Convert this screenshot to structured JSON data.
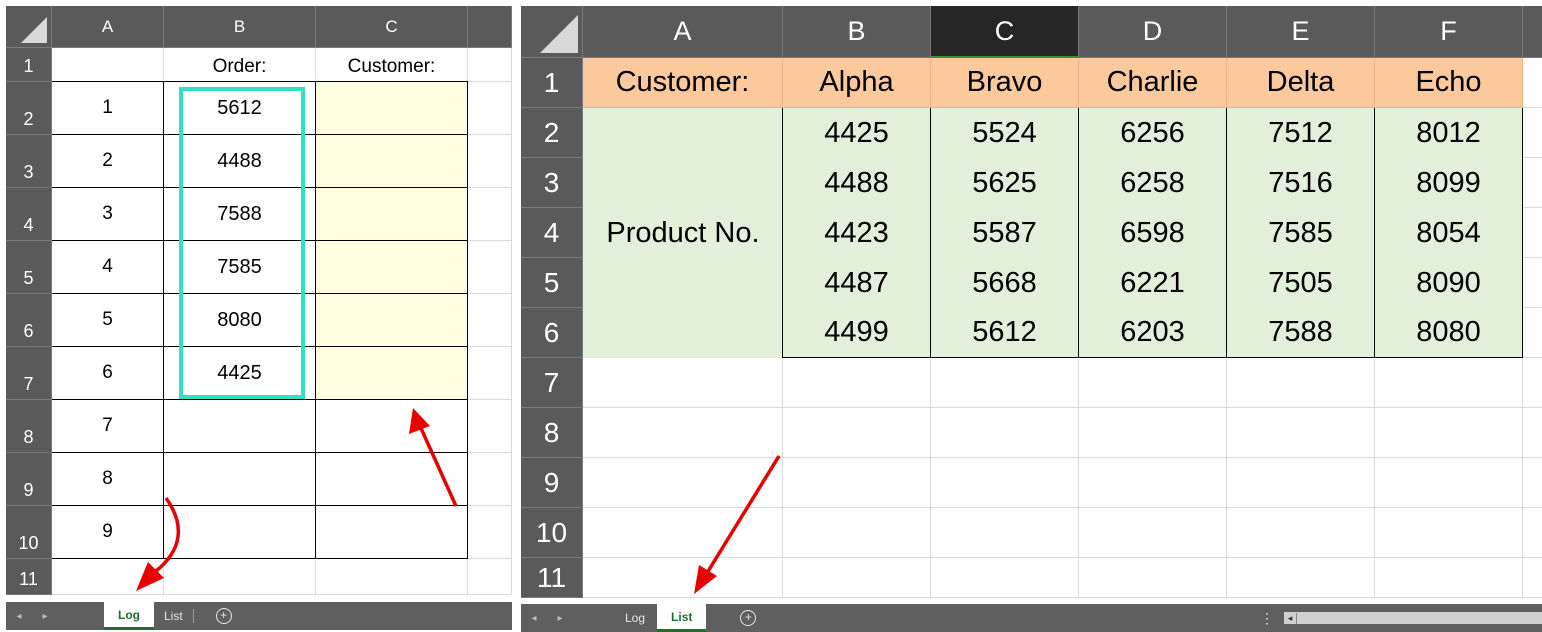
{
  "log_sheet": {
    "column_headers": [
      "A",
      "B",
      "C"
    ],
    "row_headers": [
      "1",
      "2",
      "3",
      "4",
      "5",
      "6",
      "7",
      "8",
      "9",
      "10",
      "11"
    ],
    "header_row": {
      "b": "Order:",
      "c": "Customer:"
    },
    "rows": [
      {
        "a": "1",
        "b": "5612"
      },
      {
        "a": "2",
        "b": "4488"
      },
      {
        "a": "3",
        "b": "7588"
      },
      {
        "a": "4",
        "b": "7585"
      },
      {
        "a": "5",
        "b": "8080"
      },
      {
        "a": "6",
        "b": "4425"
      },
      {
        "a": "7",
        "b": ""
      },
      {
        "a": "8",
        "b": ""
      },
      {
        "a": "9",
        "b": ""
      }
    ],
    "tabs": [
      {
        "label": "Log",
        "active": true
      },
      {
        "label": "List",
        "active": false
      }
    ]
  },
  "list_sheet": {
    "column_headers": [
      "A",
      "B",
      "C",
      "D",
      "E",
      "F"
    ],
    "selected_column": "C",
    "row_headers": [
      "1",
      "2",
      "3",
      "4",
      "5",
      "6",
      "7",
      "8",
      "9",
      "10",
      "11"
    ],
    "header_label": "Customer:",
    "customers": [
      "Alpha",
      "Bravo",
      "Charlie",
      "Delta",
      "Echo"
    ],
    "row_label": "Product No.",
    "product_rows": [
      [
        "4425",
        "5524",
        "6256",
        "7512",
        "8012"
      ],
      [
        "4488",
        "5625",
        "6258",
        "7516",
        "8099"
      ],
      [
        "4423",
        "5587",
        "6598",
        "7585",
        "8054"
      ],
      [
        "4487",
        "5668",
        "6221",
        "7505",
        "8090"
      ],
      [
        "4499",
        "5612",
        "6203",
        "7588",
        "8080"
      ]
    ],
    "tabs": [
      {
        "label": "Log",
        "active": false
      },
      {
        "label": "List",
        "active": true
      }
    ]
  },
  "icons": {
    "scroll_left": "◂",
    "scroll_right": "▸",
    "add_sheet": "+",
    "more_options": "⋮"
  },
  "colors": {
    "header_fill": "#fbc99b",
    "product_fill": "#e2efda",
    "input_fill": "#fffde0",
    "highlight_border": "#2fe0c4",
    "arrow": "#e60000",
    "active_tab_text": "#1f6e2c"
  }
}
